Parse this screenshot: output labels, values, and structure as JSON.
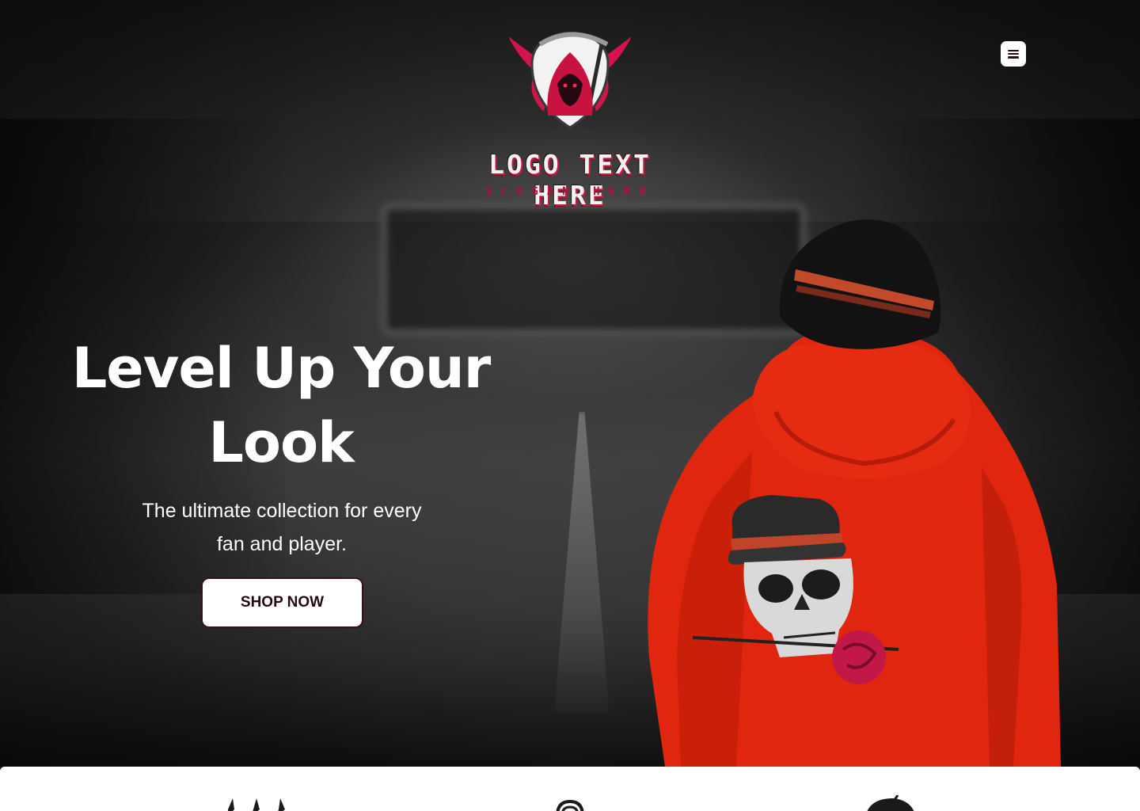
{
  "header": {
    "logo_text": "LOGO TEXT HERE",
    "logo_slogan": "SLOGAN HERE",
    "menu_icon": "hamburger-icon"
  },
  "hero": {
    "headline_line1": "Level Up Your",
    "headline_line2": "Look",
    "subheadline_line1": "The ultimate collection for every",
    "subheadline_line2": "fan and player.",
    "cta_label": "SHOP NOW"
  },
  "colors": {
    "brand_red": "#c8193f",
    "hoodie_red": "#e0260f",
    "button_text": "#24080e",
    "white": "#ffffff"
  },
  "features": {
    "icons": [
      "crown-icon",
      "controller-icon",
      "bomb-icon"
    ]
  }
}
